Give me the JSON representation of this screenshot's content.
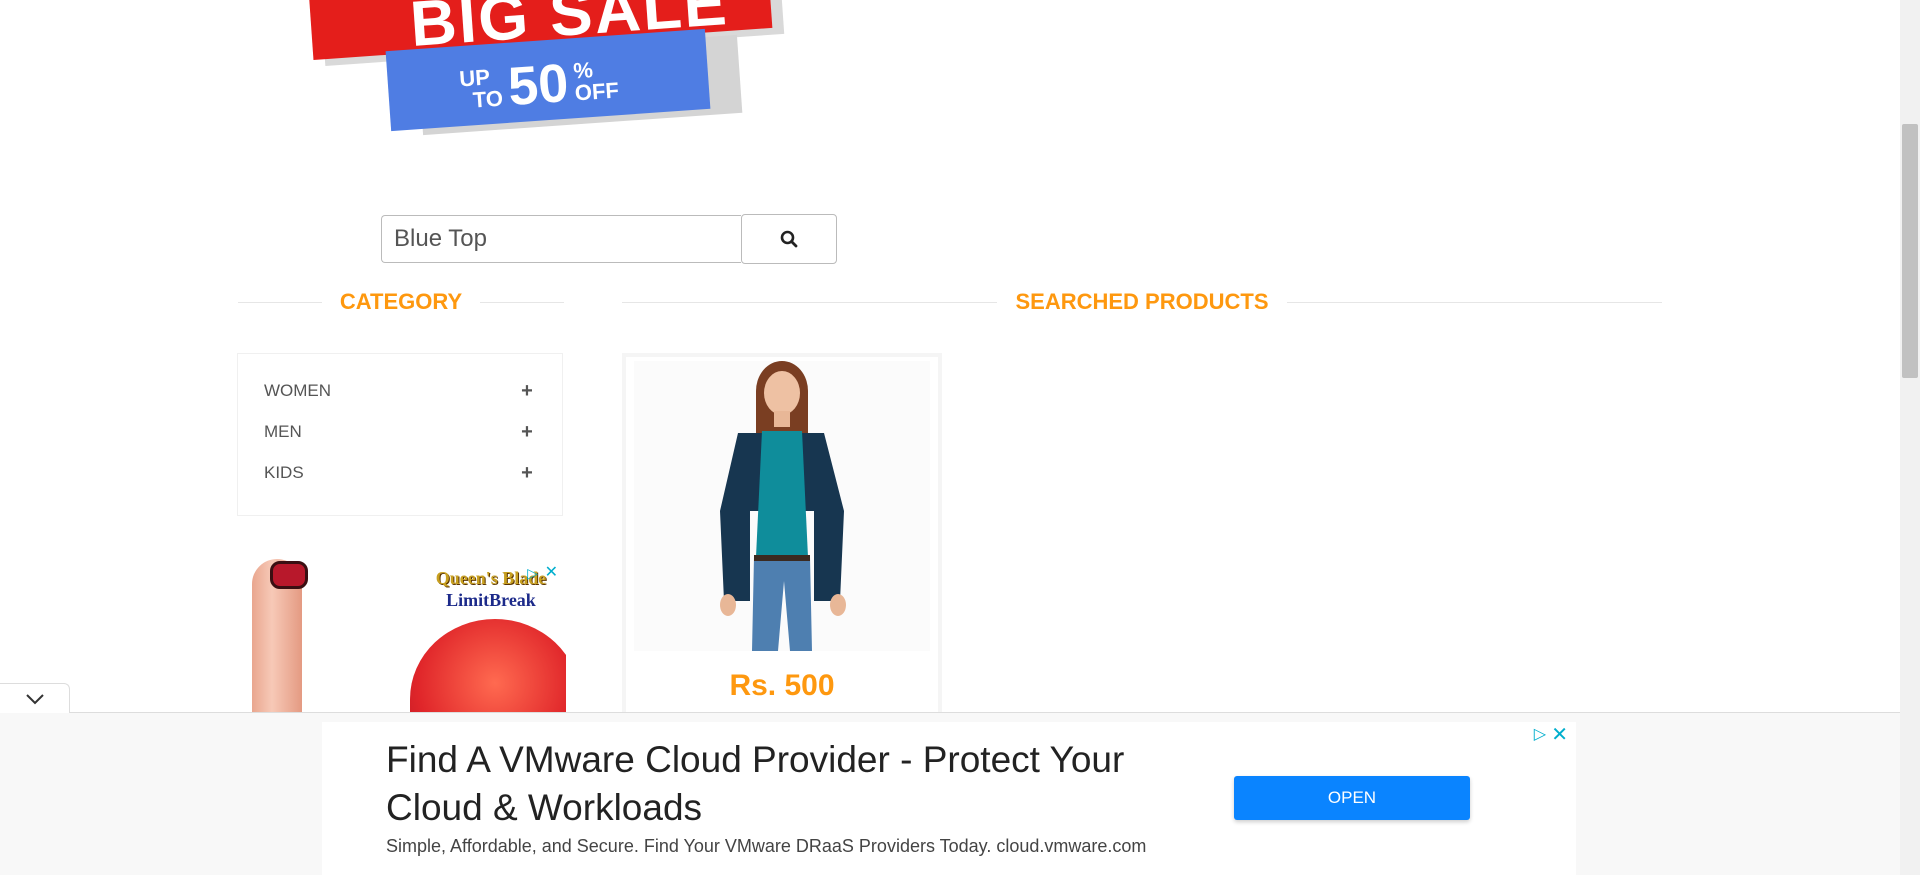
{
  "banner": {
    "headline": "BIG SALE",
    "up": "UP",
    "to": "TO",
    "percent_value": "50",
    "percent_sign": "%",
    "off": "OFF"
  },
  "search": {
    "value": "Blue Top",
    "button_icon": "search-icon"
  },
  "category": {
    "title": "CATEGORY",
    "items": [
      {
        "label": "WOMEN",
        "icon": "plus-icon"
      },
      {
        "label": "MEN",
        "icon": "plus-icon"
      },
      {
        "label": "KIDS",
        "icon": "plus-icon"
      }
    ]
  },
  "side_ad": {
    "logo_line1": "Queen's Blade",
    "logo_line2": "LimitBreak",
    "choice_icon": "adchoices-icon",
    "close_icon": "close-icon"
  },
  "products": {
    "title": "SEARCHED PRODUCTS",
    "items": [
      {
        "image": "woman-in-blue-top",
        "price": "Rs. 500"
      }
    ]
  },
  "bottom_ad": {
    "headline": "Find A VMware Cloud Provider - Protect Your Cloud & Workloads",
    "subtext": "Simple, Affordable, and Secure. Find Your VMware DRaaS Providers Today. cloud.vmware.com",
    "cta": "OPEN",
    "collapse_icon": "chevron-down-icon"
  },
  "colors": {
    "accent": "#fe980f",
    "cta": "#0a84ff",
    "banner_red": "#e41e1b",
    "banner_blue": "#4f7de3"
  }
}
